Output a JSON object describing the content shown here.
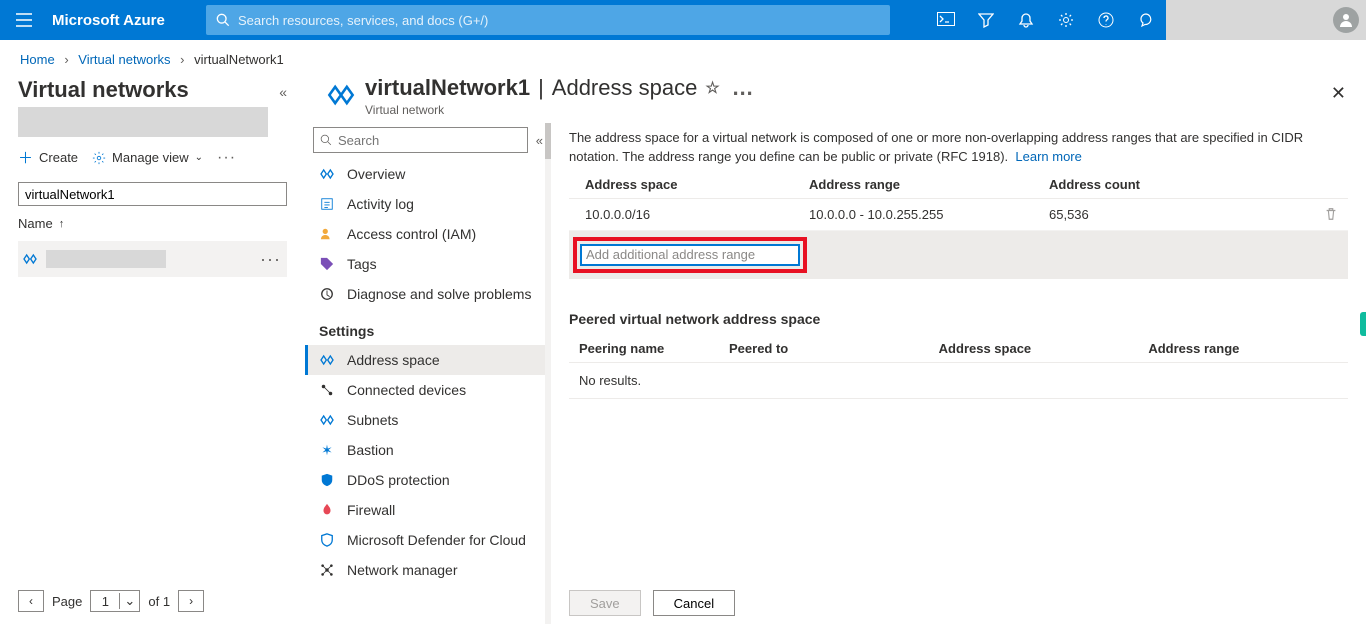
{
  "topbar": {
    "brand": "Microsoft Azure",
    "search_placeholder": "Search resources, services, and docs (G+/)"
  },
  "breadcrumb": {
    "home": "Home",
    "vnets": "Virtual networks",
    "current": "virtualNetwork1"
  },
  "list_panel": {
    "title": "Virtual networks",
    "create": "Create",
    "manage_view": "Manage view",
    "filter_value": "virtualNetwork1",
    "name_col": "Name",
    "pager_page_label": "Page",
    "pager_page": "1",
    "pager_of": "of 1"
  },
  "detail": {
    "title_main": "virtualNetwork1",
    "title_sub": "Address space",
    "subtitle": "Virtual network",
    "search_placeholder": "Search",
    "nav": {
      "overview": "Overview",
      "activity": "Activity log",
      "iam": "Access control (IAM)",
      "tags": "Tags",
      "diagnose": "Diagnose and solve problems",
      "settings": "Settings",
      "address_space": "Address space",
      "connected": "Connected devices",
      "subnets": "Subnets",
      "bastion": "Bastion",
      "ddos": "DDoS protection",
      "firewall": "Firewall",
      "defender": "Microsoft Defender for Cloud",
      "netmgr": "Network manager"
    },
    "content": {
      "desc": "The address space for a virtual network is composed of one or more non-overlapping address ranges that are specified in CIDR notation. The address range you define can be public or private (RFC 1918).",
      "learn_more": "Learn more",
      "addr_hdr_space": "Address space",
      "addr_hdr_range": "Address range",
      "addr_hdr_count": "Address count",
      "rows": [
        {
          "space": "10.0.0.0/16",
          "range": "10.0.0.0 - 10.0.255.255",
          "count": "65,536"
        }
      ],
      "add_placeholder": "Add additional address range",
      "peered_title": "Peered virtual network address space",
      "peered_hdr_name": "Peering name",
      "peered_hdr_to": "Peered to",
      "peered_hdr_space": "Address space",
      "peered_hdr_range": "Address range",
      "no_results": "No results.",
      "save": "Save",
      "cancel": "Cancel"
    }
  }
}
